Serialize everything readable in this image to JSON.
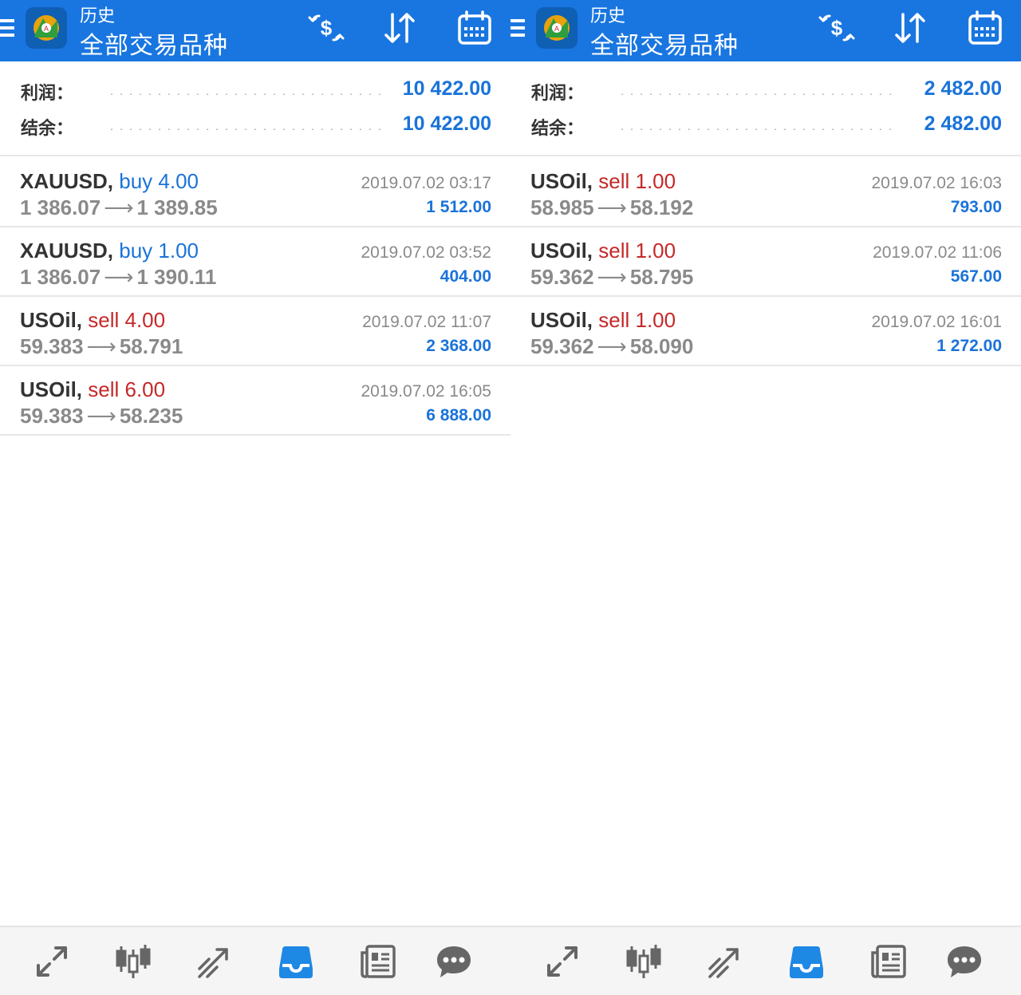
{
  "colors": {
    "header": "#1976e0",
    "buy": "#1a73d9",
    "sell": "#c62828",
    "profit": "#1a73d9"
  },
  "panels": [
    {
      "header": {
        "subtitle": "历史",
        "title": "全部交易品种"
      },
      "summary": {
        "profit_label": "利润：",
        "profit_value": "10 422.00",
        "balance_label": "结余：",
        "balance_value": "10 422.00"
      },
      "deals": [
        {
          "symbol": "XAUUSD,",
          "direction": "buy",
          "volume": "4.00",
          "open": "1 386.07",
          "close": "1 389.85",
          "time": "2019.07.02 03:17",
          "profit": "1 512.00"
        },
        {
          "symbol": "XAUUSD,",
          "direction": "buy",
          "volume": "1.00",
          "open": "1 386.07",
          "close": "1 390.11",
          "time": "2019.07.02 03:52",
          "profit": "404.00"
        },
        {
          "symbol": "USOil,",
          "direction": "sell",
          "volume": "4.00",
          "open": "59.383",
          "close": "58.791",
          "time": "2019.07.02 11:07",
          "profit": "2 368.00"
        },
        {
          "symbol": "USOil,",
          "direction": "sell",
          "volume": "6.00",
          "open": "59.383",
          "close": "58.235",
          "time": "2019.07.02 16:05",
          "profit": "6 888.00"
        }
      ]
    },
    {
      "header": {
        "subtitle": "历史",
        "title": "全部交易品种"
      },
      "summary": {
        "profit_label": "利润：",
        "profit_value": "2 482.00",
        "balance_label": "结余：",
        "balance_value": "2 482.00"
      },
      "deals": [
        {
          "symbol": "USOil,",
          "direction": "sell",
          "volume": "1.00",
          "open": "58.985",
          "close": "58.192",
          "time": "2019.07.02 16:03",
          "profit": "793.00"
        },
        {
          "symbol": "USOil,",
          "direction": "sell",
          "volume": "1.00",
          "open": "59.362",
          "close": "58.795",
          "time": "2019.07.02 11:06",
          "profit": "567.00"
        },
        {
          "symbol": "USOil,",
          "direction": "sell",
          "volume": "1.00",
          "open": "59.362",
          "close": "58.090",
          "time": "2019.07.02 16:01",
          "profit": "1 272.00"
        }
      ]
    }
  ],
  "arrow_glyph": "⟶",
  "bottom_nav": [
    {
      "icon": "quotes-icon",
      "active": false
    },
    {
      "icon": "charts-icon",
      "active": false
    },
    {
      "icon": "trade-icon",
      "active": false
    },
    {
      "icon": "history-icon",
      "active": true
    },
    {
      "icon": "news-icon",
      "active": false
    },
    {
      "icon": "chat-icon",
      "active": false
    }
  ]
}
